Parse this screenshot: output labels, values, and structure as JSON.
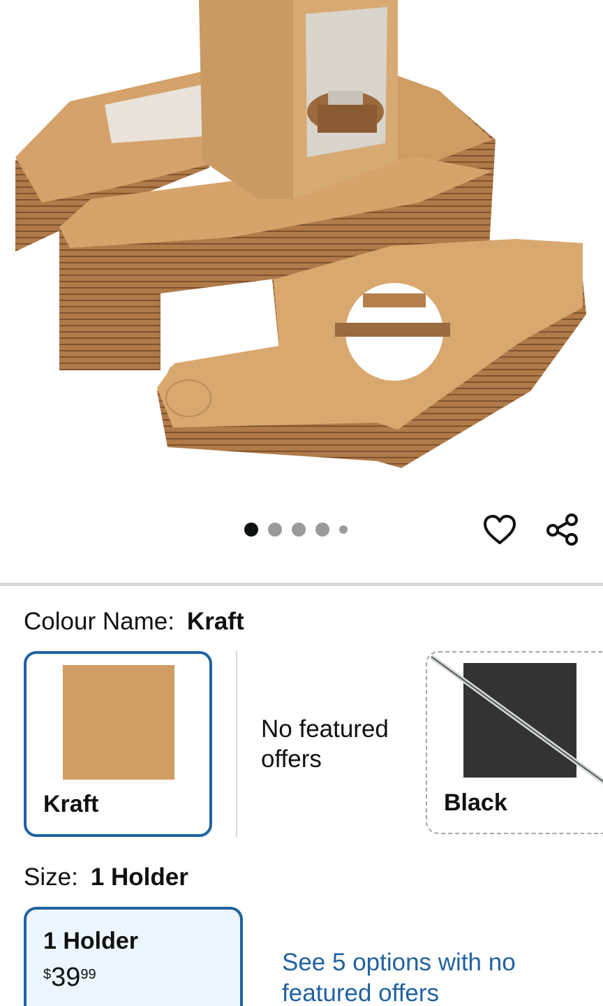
{
  "gallery": {
    "image_alt": "Kraft cupcake boxes with window and inserts",
    "dots_count": 5,
    "active_index": 0,
    "wishlist_icon": "heart-icon",
    "share_icon": "share-icon"
  },
  "colour": {
    "label": "Colour Name:",
    "selected": "Kraft",
    "options": [
      {
        "name": "Kraft",
        "color": "#d09d62",
        "state": "selected"
      },
      {
        "name": "Black",
        "color": "#333333",
        "state": "unavailable"
      }
    ],
    "no_offers_text": "No featured offers"
  },
  "size": {
    "label": "Size:",
    "selected": "1 Holder",
    "option": {
      "name": "1 Holder",
      "price_symbol": "$",
      "price_whole": "39",
      "price_fraction": "99"
    },
    "see_options_link": "See 5 options with no featured offers"
  },
  "colors": {
    "accent_blue": "#2162a1",
    "selected_bg": "#edf6ff",
    "divider": "#d5d9d9"
  }
}
